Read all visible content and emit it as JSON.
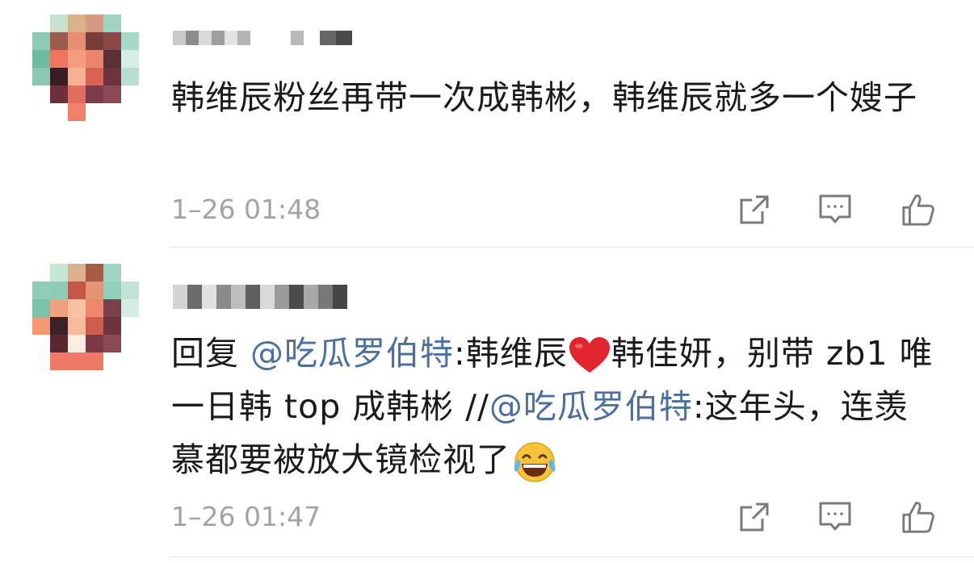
{
  "comments": [
    {
      "body": "韩维辰粉丝再带一次成韩彬，韩维辰就多一个嫂子",
      "time": "1–26 01:48"
    },
    {
      "reply_prefix": "回复 ",
      "mention1": "@吃瓜罗伯特",
      "text1": ":韩维辰",
      "text2": "韩佳妍，别带 zb1 唯一日韩 top 成韩彬 //",
      "mention2": "@吃瓜罗伯特",
      "text3": ":这年头，连羡慕都要被放大镜检视了",
      "time": "1–26 01:47"
    }
  ],
  "icons": {
    "share": "share-icon",
    "comment": "comment-icon",
    "like": "thumbs-up-icon",
    "heart": "red-heart-emoji",
    "laugh": "tears-of-joy-emoji"
  },
  "colors": {
    "mention": "#4a6fa0",
    "timestamp": "#a3a3a3",
    "icon": "#7a7a7a",
    "heart": "#e0252d"
  }
}
